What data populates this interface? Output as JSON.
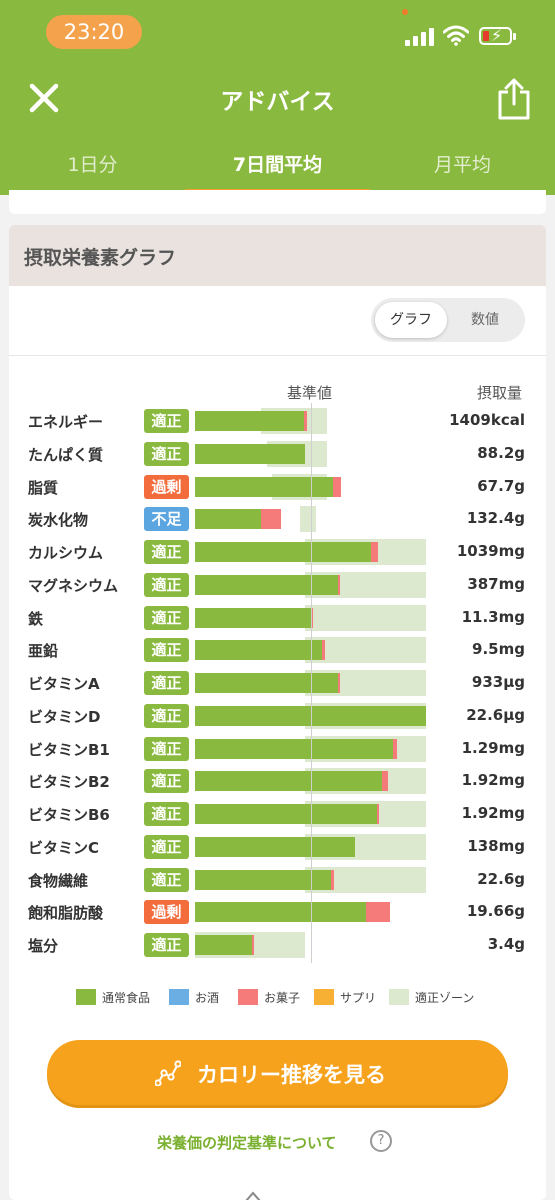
{
  "status_bar": {
    "time": "23:20"
  },
  "header": {
    "title": "アドバイス"
  },
  "tabs": [
    {
      "label": "1日分",
      "active": false
    },
    {
      "label": "7日間平均",
      "active": true
    },
    {
      "label": "月平均",
      "active": false
    }
  ],
  "card": {
    "title": "摂取栄養素グラフ",
    "toggle": {
      "graph_label": "グラフ",
      "value_label": "数値",
      "selected": "グラフ"
    },
    "column_headers": {
      "baseline": "基準値",
      "intake": "摂取量"
    }
  },
  "nutrients": [
    {
      "name": "エネルギー",
      "status": "適正",
      "value": "1409kcal",
      "bar_ratio": 0.99,
      "snack_ratio": 0.03,
      "zone": [
        0.6,
        1.2
      ]
    },
    {
      "name": "たんぱく質",
      "status": "適正",
      "value": "88.2g",
      "bar_ratio": 1.0,
      "snack_ratio": 0.0,
      "zone": [
        0.65,
        1.2
      ]
    },
    {
      "name": "脂質",
      "status": "過剰",
      "value": "67.7g",
      "bar_ratio": 1.25,
      "snack_ratio": 0.08,
      "zone": [
        0.7,
        1.2
      ]
    },
    {
      "name": "炭水化物",
      "status": "不足",
      "value": "132.4g",
      "bar_ratio": 0.6,
      "snack_ratio": 0.18,
      "zone": [
        0.95,
        1.1
      ]
    },
    {
      "name": "カルシウム",
      "status": "適正",
      "value": "1039mg",
      "bar_ratio": 1.6,
      "snack_ratio": 0.06,
      "zone": [
        1.0,
        2.1
      ]
    },
    {
      "name": "マグネシウム",
      "status": "適正",
      "value": "387mg",
      "bar_ratio": 1.3,
      "snack_ratio": 0.02,
      "zone": [
        1.0,
        2.1
      ]
    },
    {
      "name": "鉄",
      "status": "適正",
      "value": "11.3mg",
      "bar_ratio": 1.05,
      "snack_ratio": 0.02,
      "zone": [
        1.0,
        2.1
      ]
    },
    {
      "name": "亜鉛",
      "status": "適正",
      "value": "9.5mg",
      "bar_ratio": 1.15,
      "snack_ratio": 0.03,
      "zone": [
        1.0,
        2.1
      ]
    },
    {
      "name": "ビタミンA",
      "status": "適正",
      "value": "933µg",
      "bar_ratio": 1.3,
      "snack_ratio": 0.02,
      "zone": [
        1.0,
        2.1
      ]
    },
    {
      "name": "ビタミンD",
      "status": "適正",
      "value": "22.6µg",
      "bar_ratio": 2.1,
      "snack_ratio": 0.0,
      "zone": [
        1.0,
        2.1
      ]
    },
    {
      "name": "ビタミンB1",
      "status": "適正",
      "value": "1.29mg",
      "bar_ratio": 1.8,
      "snack_ratio": 0.04,
      "zone": [
        1.0,
        2.1
      ]
    },
    {
      "name": "ビタミンB2",
      "status": "適正",
      "value": "1.92mg",
      "bar_ratio": 1.7,
      "snack_ratio": 0.05,
      "zone": [
        1.0,
        2.1
      ]
    },
    {
      "name": "ビタミンB6",
      "status": "適正",
      "value": "1.92mg",
      "bar_ratio": 1.65,
      "snack_ratio": 0.02,
      "zone": [
        1.0,
        2.1
      ]
    },
    {
      "name": "ビタミンC",
      "status": "適正",
      "value": "138mg",
      "bar_ratio": 1.45,
      "snack_ratio": 0.0,
      "zone": [
        1.0,
        2.1
      ]
    },
    {
      "name": "食物繊維",
      "status": "適正",
      "value": "22.6g",
      "bar_ratio": 1.24,
      "snack_ratio": 0.02,
      "zone": [
        1.0,
        2.1
      ]
    },
    {
      "name": "飽和脂肪酸",
      "status": "過剰",
      "value": "19.66g",
      "bar_ratio": 1.55,
      "snack_ratio": 0.22,
      "zone": [
        0.0,
        0.0
      ]
    },
    {
      "name": "塩分",
      "status": "適正",
      "value": "3.4g",
      "bar_ratio": 0.52,
      "snack_ratio": 0.02,
      "zone": [
        0.0,
        1.0
      ]
    }
  ],
  "status_colors": {
    "適正": "#8ab93f",
    "過剰": "#f36c3c",
    "不足": "#5ba5e0"
  },
  "legend": [
    {
      "label": "通常食品",
      "color": "#8ab93f"
    },
    {
      "label": "お酒",
      "color": "#6aaee3"
    },
    {
      "label": "お菓子",
      "color": "#f57b7b"
    },
    {
      "label": "サプリ",
      "color": "#f7b034"
    },
    {
      "label": "適正ゾーン",
      "color": "#dce9cf"
    }
  ],
  "cta": {
    "label": "カロリー推移を見る"
  },
  "criteria_link": {
    "label": "栄養価の判定基準について"
  }
}
